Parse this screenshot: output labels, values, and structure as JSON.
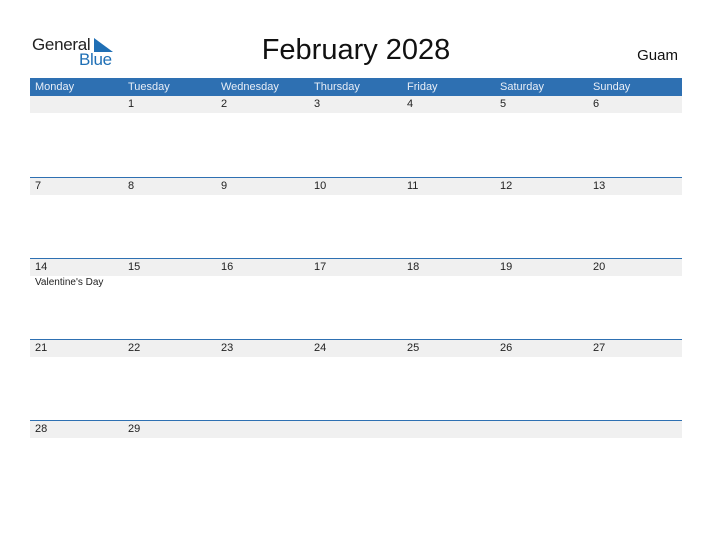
{
  "logo": {
    "line1": "General",
    "line2": "Blue",
    "accent": "#1f6fb5"
  },
  "title": "February 2028",
  "country": "Guam",
  "colors": {
    "header_bg": "#2e70b2",
    "strip_bg": "#f0f0f0"
  },
  "weekdays": [
    "Monday",
    "Tuesday",
    "Wednesday",
    "Thursday",
    "Friday",
    "Saturday",
    "Sunday"
  ],
  "weeks": [
    {
      "days": [
        "",
        "1",
        "2",
        "3",
        "4",
        "5",
        "6"
      ],
      "events": [
        "",
        "",
        "",
        "",
        "",
        "",
        ""
      ]
    },
    {
      "days": [
        "7",
        "8",
        "9",
        "10",
        "11",
        "12",
        "13"
      ],
      "events": [
        "",
        "",
        "",
        "",
        "",
        "",
        ""
      ]
    },
    {
      "days": [
        "14",
        "15",
        "16",
        "17",
        "18",
        "19",
        "20"
      ],
      "events": [
        "Valentine's Day",
        "",
        "",
        "",
        "",
        "",
        ""
      ]
    },
    {
      "days": [
        "21",
        "22",
        "23",
        "24",
        "25",
        "26",
        "27"
      ],
      "events": [
        "",
        "",
        "",
        "",
        "",
        "",
        ""
      ]
    },
    {
      "days": [
        "28",
        "29",
        "",
        "",
        "",
        "",
        ""
      ],
      "events": [
        "",
        "",
        "",
        "",
        "",
        "",
        ""
      ]
    }
  ]
}
